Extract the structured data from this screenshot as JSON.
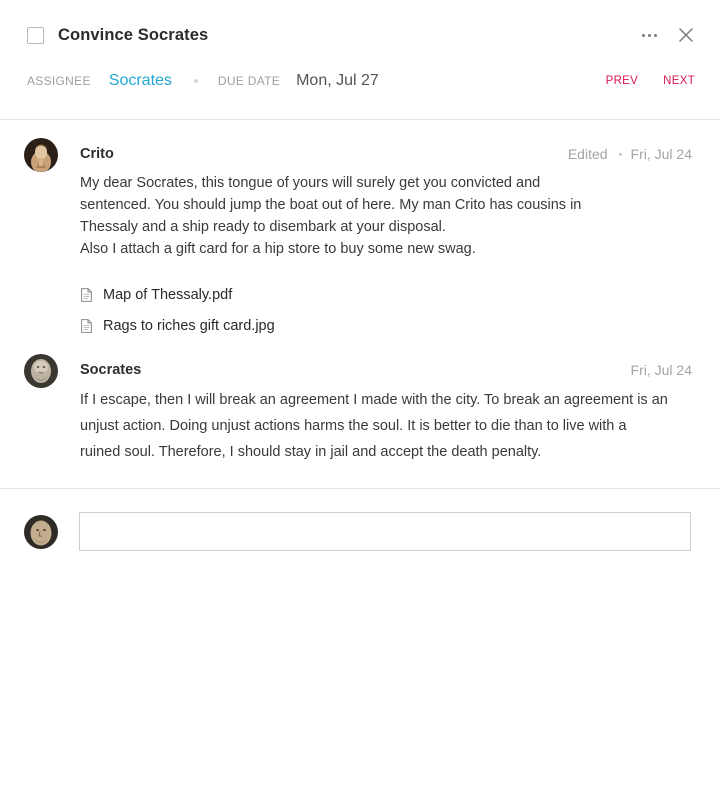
{
  "task": {
    "title": "Convince Socrates",
    "assignee_label": "ASSIGNEE",
    "assignee": "Socrates",
    "due_label": "DUE DATE",
    "due_date": "Mon, Jul 27",
    "prev_label": "PREV",
    "next_label": "NEXT"
  },
  "comments": [
    {
      "author": "Crito",
      "edited_label": "Edited",
      "date": "Fri, Jul 24",
      "lines": [
        "My dear Socrates, this tongue of yours will surely get you convicted and sentenced. You should jump the boat out of here. My man Crito has cousins in Thessaly and a ship ready to disembark at your disposal.",
        "Also I attach a gift card for a hip store to buy some new swag."
      ],
      "attachments": [
        {
          "name": "Map of Thessaly.pdf",
          "icon": "document-icon"
        },
        {
          "name": "Rags to riches gift card.jpg",
          "icon": "document-icon"
        }
      ]
    },
    {
      "author": "Socrates",
      "date": "Fri, Jul 24",
      "text": "If I escape, then I will break an agreement I made with the city. To break an agreement is an unjust action. Doing unjust actions harms the soul. It is better to die than to live with a ruined soul. Therefore, I should stay in jail and accept the death penalty."
    }
  ],
  "composer": {
    "value": "",
    "placeholder": ""
  },
  "colors": {
    "accent_blue": "#22a8d0",
    "nav_red": "#d9174e",
    "muted_gray": "#9aa0a6"
  },
  "icons": {
    "checkbox": "checkbox-icon",
    "more": "more-horizontal-icon",
    "close": "close-icon",
    "file": "document-icon"
  }
}
